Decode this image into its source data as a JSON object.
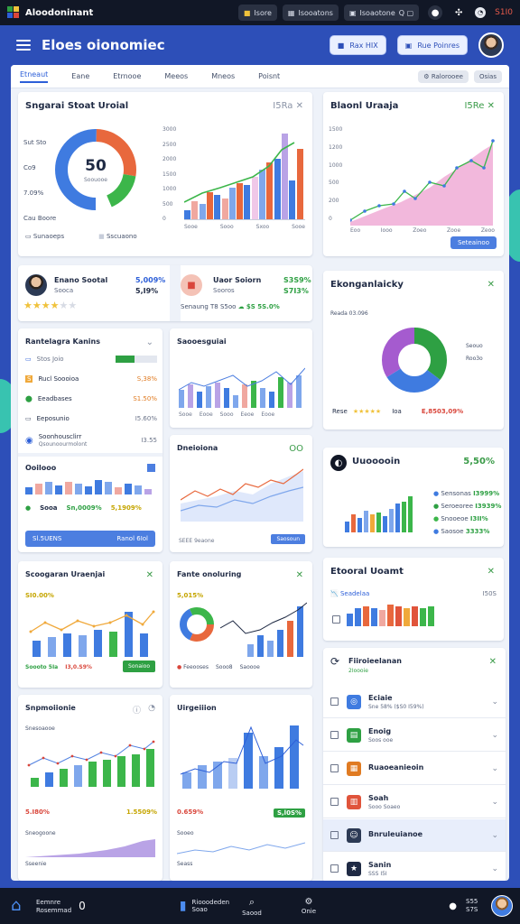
{
  "colors": {
    "accent": "#2d5fd8",
    "green": "#2ea043",
    "red": "#d9463b",
    "orange": "#e07b22",
    "topbar": "#111726",
    "bg": "#2d4fb8"
  },
  "topbar": {
    "app_title": "Aloodoninant",
    "pill1": "Isore",
    "pill2": "Isooatons",
    "pill3": "Isoaotone",
    "pill3_icons": "Q ▢",
    "time": "S1I0"
  },
  "header": {
    "title": "Eloes oionomiec",
    "btn1": "Rax HIX",
    "btn2": "Rue  Poinres"
  },
  "tabs": [
    "Etneaut",
    "Eane",
    "Etrnooe",
    "Meeos",
    "Mneos",
    "Poisnt"
  ],
  "tab_actions": {
    "action1": "Ralorooee",
    "action2": "Osias"
  },
  "card1": {
    "title": "Sngarai  Stoat Uroial",
    "status": "I5Ra",
    "donut_value": "50",
    "donut_sub": "Soouooe",
    "legend": [
      "Sut Sto",
      "Co9",
      "7.09%",
      "Cau Boore"
    ],
    "footer1": "Sunaoeps",
    "footer2": "Sscuaono",
    "chart_data": {
      "type": "bar",
      "categories": [
        "Sooe",
        "Sooo",
        "Sxoo",
        "Sooe"
      ],
      "values": [
        800,
        1150,
        1650,
        2850
      ],
      "ylim": [
        0,
        3000
      ],
      "yticks": [
        "3000",
        "2500",
        "2000",
        "1500",
        "1000",
        "500",
        "0"
      ]
    }
  },
  "card2": {
    "title": "Blaonl Uraaja",
    "status": "I5Re",
    "chart_data": {
      "type": "area",
      "x": [
        "Eoo",
        "Iooo",
        "Zoeo",
        "Zooe",
        "Zeoo"
      ],
      "values": [
        200,
        350,
        650,
        800,
        1300
      ],
      "ylim": [
        0,
        1500
      ],
      "yticks": [
        "1500",
        "1200",
        "1000",
        "500",
        "200",
        "0"
      ]
    },
    "button": "Seteainoo"
  },
  "profile1": {
    "name": "Enano Sootal",
    "role": "Sooca",
    "v1": "5,009%",
    "v2": "5,I9%"
  },
  "profile2": {
    "name": "Uaor Soiorn",
    "role": "Sooros",
    "v1": "S3S9%",
    "v2": "S7I3%",
    "footer": "Senaung  T8 S5oo",
    "footer_val": "$S 5S.0%"
  },
  "card3": {
    "title": "Rantelagra Kanins",
    "rows": [
      {
        "label": "Stos Joio",
        "val": ""
      },
      {
        "label": "Rucl Soooioa",
        "val": "S,38%"
      },
      {
        "label": "Eeadbases",
        "val": "S1.50%"
      },
      {
        "label": "Eeposunio",
        "val": "I5.60%"
      },
      {
        "label": "Soonhousclirr",
        "sub": "Qsounoourmolont",
        "val": "I3.55"
      }
    ]
  },
  "card4": {
    "title": "Saooesguiai",
    "xlbl": "Sooe",
    "chart_data": {
      "type": "bar",
      "categories": [
        "Sooe",
        "Eooe",
        "Sooo",
        "Eeoe",
        "Eooe"
      ],
      "values": [
        35,
        48,
        30,
        42,
        50,
        38,
        20,
        44,
        55
      ]
    }
  },
  "card5": {
    "title": "Ekonganlaicky",
    "sub": "Reada 03.096",
    "footer": "Rese",
    "rating": "Ioa",
    "footer_val": "E,8503,09%",
    "chart_data": {
      "type": "pie",
      "values": [
        35,
        30,
        35
      ],
      "labels": [
        "Seouo",
        "Roo3o",
        ""
      ]
    }
  },
  "card6": {
    "title": "Ooilooo",
    "stats": [
      "Sooa",
      "Sn,0009%",
      "5,1909%"
    ],
    "button1": "Sl.5UENS",
    "button2": "Ranol 6Iol"
  },
  "card7": {
    "title": "Dneioiona",
    "status": "OO",
    "xlbl": "SEEE 9eaone",
    "button": "Saosoun"
  },
  "card8": {
    "title": "Uuooooin",
    "status": "5,50%",
    "legend": [
      "Sensonas",
      "I3999%",
      "Seroeoree",
      "I3939%",
      "Snooeoe",
      "I3II%",
      "Saosoe",
      "3333%"
    ]
  },
  "card9": {
    "title": "Scoogaran Uraenjai",
    "sub": "SI0.00%",
    "stat1": "Soooto 5Ia",
    "stat2": "I3,0.S9%",
    "button": "Sonaioo"
  },
  "card10": {
    "title": "Fante onoluring",
    "sub": "5,015%",
    "stats": [
      "Feeooses",
      "Sooo8",
      "Saoooe"
    ]
  },
  "card11": {
    "title": "Etooral Uoamt",
    "sub": "Seadelaa",
    "status": "I50S"
  },
  "card12": {
    "title": "Snpmoiionie",
    "sub": "Snesoaooe",
    "stat1": "5.I80%",
    "stat2": "1.5509%",
    "footer": "Sneogoone",
    "footer2": "Sseenie"
  },
  "card13": {
    "title": "Uirgeiiion",
    "stat1": "0.659%",
    "stat2": "S,l0S%",
    "footer": "Sooeo",
    "footer2": "Seass"
  },
  "list": {
    "title": "Fiiroieelanan",
    "title_sub": "2Ioooie",
    "items": [
      {
        "title": "Eciaie",
        "sub": "Sne 58%  ($S0 I59%)",
        "color": "#3f7be0",
        "icon": "◎"
      },
      {
        "title": "Enoig",
        "sub": "Soos ooe",
        "color": "#2ea043",
        "icon": "▤"
      },
      {
        "title": "Ruaoeanieoin",
        "sub": "",
        "color": "#e07b22",
        "icon": "▦"
      },
      {
        "title": "Soah",
        "sub": "Sooo Soaeo",
        "color": "#e0543b",
        "icon": "▥"
      },
      {
        "title": "Bnruleuianoe",
        "sub": "",
        "color": "#2c3a55",
        "icon": "☺"
      },
      {
        "title": "Sanin",
        "sub": "SSS I5I",
        "color": "#1f2a44",
        "icon": "★"
      }
    ]
  },
  "bottombar": {
    "home": "Eemnre",
    "home_sub": "Rosemmad",
    "count": "0",
    "nav1": "Riooodeden",
    "nav1_sub": "Soao",
    "nav2": "Saood",
    "nav3": "Onie",
    "time": "S55 S7S"
  }
}
